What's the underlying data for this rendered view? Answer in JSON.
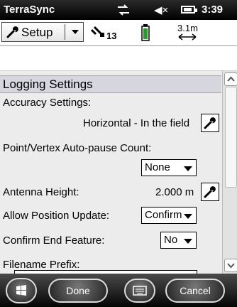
{
  "statusbar": {
    "app_name": "TerraSync",
    "time": "3:39",
    "volume_symbol": "◀×"
  },
  "toolbar": {
    "setup_label": "Setup",
    "satellite_count": "13",
    "range": "3.1m"
  },
  "section": {
    "title": "Logging Settings"
  },
  "settings": {
    "accuracy_label": "Accuracy Settings:",
    "accuracy_value": "Horizontal - In the field",
    "autopause_label": "Point/Vertex Auto-pause Count:",
    "autopause_value": "None",
    "antenna_label": "Antenna Height:",
    "antenna_value": "2.000 m",
    "position_update_label": "Allow Position Update:",
    "position_update_value": "Confirm",
    "confirm_end_label": "Confirm End Feature:",
    "confirm_end_value": "No",
    "prefix_label": "Filename Prefix:"
  },
  "softkeys": {
    "done": "Done",
    "cancel": "Cancel"
  },
  "icons": [
    "network-icon",
    "volume-icon",
    "battery-icon",
    "wrench-icon",
    "dropdown-arrow-icon",
    "satellite-icon",
    "receiver-battery-icon",
    "range-arrow-icon",
    "windows-start-icon",
    "keyboard-icon",
    "scroll-up-icon",
    "scroll-down-icon"
  ]
}
